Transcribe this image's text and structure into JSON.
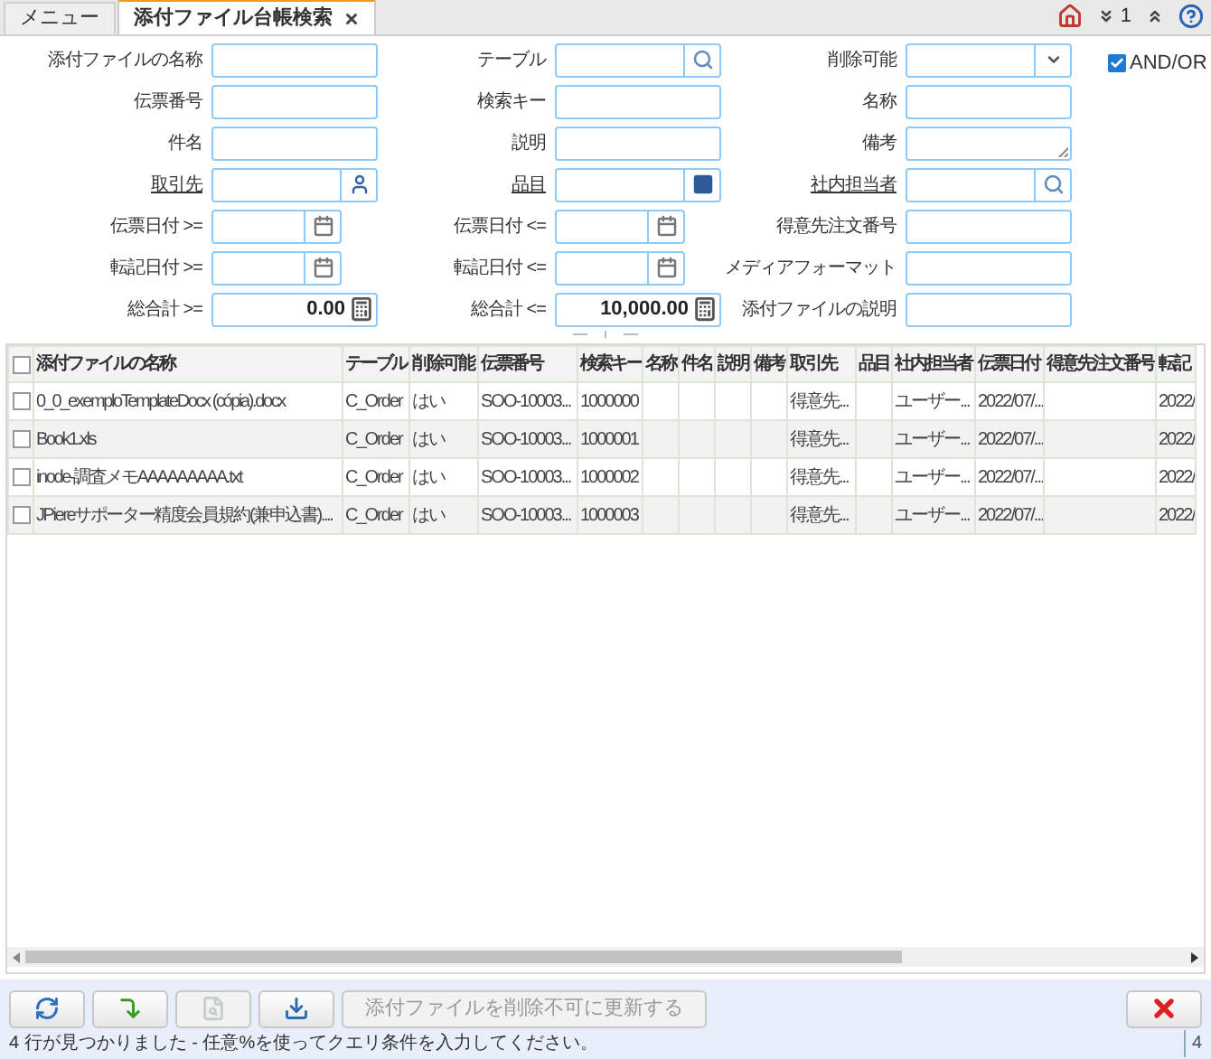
{
  "tabs": [
    {
      "label": "メニュー",
      "selected": false,
      "closable": false
    },
    {
      "label": "添付ファイル台帳検索",
      "selected": true,
      "closable": true
    }
  ],
  "header_tools": {
    "expand_count": "1"
  },
  "search_form": {
    "fields": [
      {
        "label": "添付ファイルの名称",
        "kind": "text",
        "linked": false
      },
      {
        "label": "テーブル",
        "kind": "lookup",
        "linked": false
      },
      {
        "label": "削除可能",
        "kind": "select",
        "linked": false
      },
      {
        "label": "伝票番号",
        "kind": "text",
        "linked": false
      },
      {
        "label": "検索キー",
        "kind": "text",
        "linked": false
      },
      {
        "label": "名称",
        "kind": "text",
        "linked": false
      },
      {
        "label": "件名",
        "kind": "text",
        "linked": false
      },
      {
        "label": "説明",
        "kind": "text",
        "linked": false
      },
      {
        "label": "備考",
        "kind": "textarea",
        "linked": false
      },
      {
        "label": "取引先",
        "kind": "partner",
        "linked": true
      },
      {
        "label": "品目",
        "kind": "product",
        "linked": true
      },
      {
        "label": "社内担当者",
        "kind": "lookup",
        "linked": true
      },
      {
        "label": "伝票日付 >=",
        "kind": "date",
        "linked": false
      },
      {
        "label": "伝票日付 <=",
        "kind": "date",
        "linked": false
      },
      {
        "label": "得意先注文番号",
        "kind": "text",
        "linked": false
      },
      {
        "label": "転記日付 >=",
        "kind": "date",
        "linked": false
      },
      {
        "label": "転記日付 <=",
        "kind": "date",
        "linked": false
      },
      {
        "label": "メディアフォーマット",
        "kind": "text",
        "linked": false
      },
      {
        "label": "総合計 >=",
        "kind": "number",
        "value": "0.00",
        "linked": false
      },
      {
        "label": "総合計 <=",
        "kind": "number",
        "value": "10,000.00",
        "linked": false
      },
      {
        "label": "添付ファイルの説明",
        "kind": "text",
        "linked": false
      }
    ],
    "and_or": {
      "label": "AND/OR",
      "checked": true
    }
  },
  "table": {
    "all_checked": false,
    "columns": [
      "添付ファイルの名称",
      "テーブル",
      "削除可能",
      "伝票番号",
      "検索キー",
      "名称",
      "件名",
      "説明",
      "備考",
      "取引先",
      "品目",
      "社内担当者",
      "伝票日付",
      "得意先注文番号",
      "転記"
    ],
    "rows": [
      {
        "checked": false,
        "cells": [
          "0_0_exemploTemplateDocx (cópia).docx",
          "C_Order",
          "はい",
          "SOO-10003...",
          "1000000",
          null,
          null,
          null,
          null,
          "得意先...",
          null,
          "ユーザー...",
          "2022/07/...",
          null,
          "2022/"
        ]
      },
      {
        "checked": false,
        "cells": [
          "Book1.xls",
          "C_Order",
          "はい",
          "SOO-10003...",
          "1000001",
          null,
          null,
          null,
          null,
          "得意先...",
          null,
          "ユーザー...",
          "2022/07/...",
          null,
          "2022/"
        ]
      },
      {
        "checked": false,
        "cells": [
          "inode-調査メモAAAAAAAAA.txt",
          "C_Order",
          "はい",
          "SOO-10003...",
          "1000002",
          null,
          null,
          null,
          null,
          "得意先...",
          null,
          "ユーザー...",
          "2022/07/...",
          null,
          "2022/"
        ]
      },
      {
        "checked": false,
        "cells": [
          "JPiereサポーター精度会員規約(兼申込書)....",
          "C_Order",
          "はい",
          "SOO-10003...",
          "1000003",
          null,
          null,
          null,
          null,
          "得意先...",
          null,
          "ユーザー...",
          "2022/07/...",
          null,
          "2022/"
        ]
      }
    ]
  },
  "toolbar": {
    "buttons": [
      {
        "kind": "refresh",
        "disabled": false
      },
      {
        "kind": "zoom",
        "disabled": false
      },
      {
        "kind": "preview",
        "disabled": true
      },
      {
        "kind": "export",
        "disabled": false
      },
      {
        "kind": "text",
        "label": "添付ファイルを削除不可に更新する",
        "disabled": true
      }
    ],
    "close": {
      "disabled": false
    }
  },
  "status_bar": {
    "message": "4 行が見つかりました - 任意%を使ってクエリ条件を入力してください。",
    "count": "4"
  }
}
